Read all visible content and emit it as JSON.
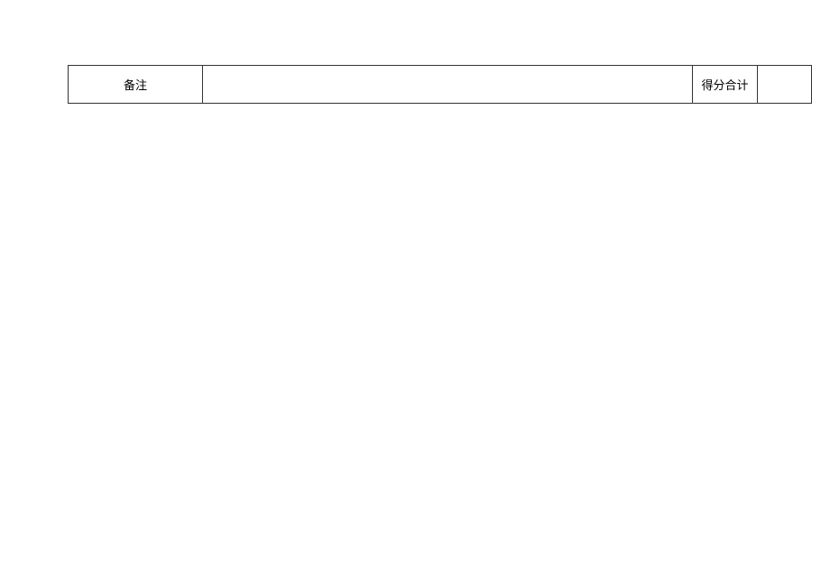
{
  "row": {
    "remarks_label": "备注",
    "remarks_content": "",
    "total_label": "得分合计",
    "total_value": ""
  }
}
